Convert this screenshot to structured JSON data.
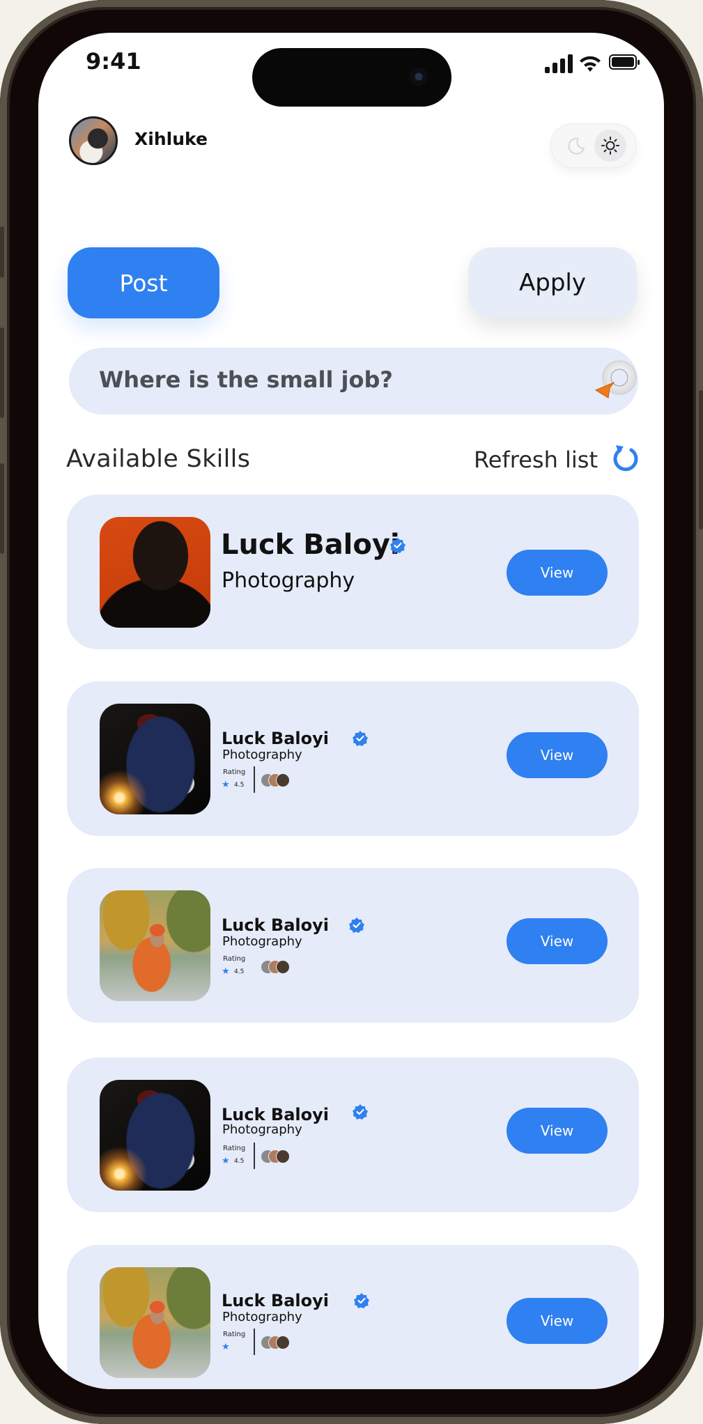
{
  "status_bar": {
    "time": "9:41"
  },
  "header": {
    "username": "Xihluke"
  },
  "actions": {
    "post_label": "Post",
    "apply_label": "Apply"
  },
  "search": {
    "placeholder": "Where is the small job?"
  },
  "section": {
    "title": "Available Skills",
    "refresh_label": "Refresh list"
  },
  "colors": {
    "accent": "#2f80f0",
    "card_bg": "#e5ebf8",
    "search_icon_arrow": "#f07a1a"
  },
  "cards": [
    {
      "name": "Luck Baloyi",
      "skill": "Photography",
      "button": "View"
    },
    {
      "name": "Luck Baloyi",
      "skill": "Photography",
      "rating_label": "Rating",
      "rating_value": "4.5",
      "button": "View"
    },
    {
      "name": "Luck Baloyi",
      "skill": "Photography",
      "rating_label": "Rating",
      "rating_value": "4.5",
      "button": "View"
    },
    {
      "name": "Luck Baloyi",
      "skill": "Photography",
      "rating_label": "Rating",
      "rating_value": "4.5",
      "button": "View"
    },
    {
      "name": "Luck Baloyi",
      "skill": "Photography",
      "rating_label": "Rating",
      "button": "View"
    }
  ]
}
